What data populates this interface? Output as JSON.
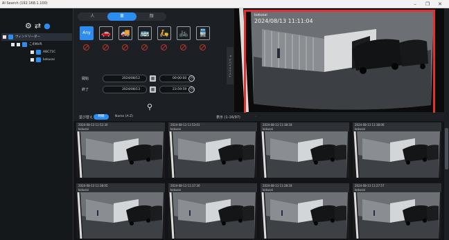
{
  "window": {
    "title": "AI Search (192.168.1.100)",
    "min": "–",
    "max": "❐",
    "close": "✕"
  },
  "sidebar": {
    "tree": [
      {
        "label": "ウィンドリーダー",
        "level": 0
      },
      {
        "label": "このNVR",
        "level": 1
      },
      {
        "label": "ABC71C",
        "level": 2
      },
      {
        "label": "kokusai",
        "level": 2
      }
    ]
  },
  "search": {
    "tabs": [
      "人",
      "車",
      "顔"
    ],
    "active_tab": 1,
    "types": [
      {
        "label": "Any",
        "icon": "any-icon"
      },
      {
        "label": "🚗",
        "icon": "car-icon"
      },
      {
        "label": "🚚",
        "icon": "truck-icon"
      },
      {
        "label": "🚌",
        "icon": "bus-icon"
      },
      {
        "label": "🛵",
        "icon": "motorbike-icon"
      },
      {
        "label": "🚲",
        "icon": "bicycle-icon"
      },
      {
        "label": "🚆",
        "icon": "train-icon"
      }
    ],
    "start_label": "開始",
    "end_label": "終了",
    "start_date": "2024/08/12",
    "start_time": "00:00:00",
    "end_date": "2024/08/13",
    "end_time": "23:59:59",
    "collapse": "◂ デバイスリスト"
  },
  "live": {
    "cam_name": "kokusai",
    "timestamp": "2024/08/13 11:11:04"
  },
  "results": {
    "sort_label": "並び替え",
    "sort_time": "時間",
    "sort_name": "Name (A-Z)",
    "count_label": "表示 (1-16/97)",
    "items": [
      {
        "time": "2024-08-13 11:52:30",
        "cam": "kokusai"
      },
      {
        "time": "2024-08-13 11:53:01",
        "cam": "kokusai"
      },
      {
        "time": "2024-08-13 11:38:18",
        "cam": "kokusai"
      },
      {
        "time": "2024-08-13 11:38:06",
        "cam": "kokusai"
      },
      {
        "time": "2024-08-13 11:38:05",
        "cam": "kokusai"
      },
      {
        "time": "2024-08-13 11:37:30",
        "cam": "kokusai"
      },
      {
        "time": "2024-08-13 11:28:18",
        "cam": "kokusai"
      },
      {
        "time": "2024-08-13 11:27:57",
        "cam": "kokusai"
      }
    ]
  }
}
